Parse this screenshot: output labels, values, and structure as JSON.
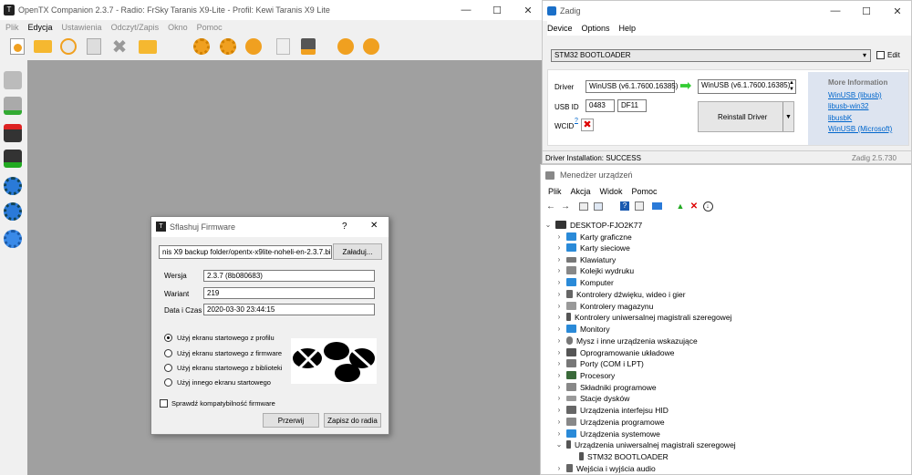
{
  "opentx": {
    "title": "OpenTX Companion 2.3.7 - Radio: FrSky Taranis X9-Lite - Profil: Kewi Taranis X9 Lite",
    "app_icon": "T",
    "menu": [
      "Plik",
      "Edycja",
      "Ustawienia",
      "Odczyt/Zapis",
      "Okno",
      "Pomoc"
    ],
    "toolbar_icons": [
      "new-file-icon",
      "open-folder-icon",
      "recent-files-icon",
      "save-icon",
      "close-x-icon",
      "model-folder-icon",
      "settings-gear-icon",
      "profile-gear-icon",
      "radio-settings-icon",
      "logs-icon",
      "sd-card-icon",
      "sync-icon",
      "download-firmware-icon"
    ],
    "side_icons": [
      "read-model-icon",
      "write-model-icon",
      "read-backup-icon",
      "write-backup-icon",
      "read-firmware-icon",
      "write-firmware-icon",
      "flash-firmware-icon"
    ]
  },
  "flash_dialog": {
    "title": "Sflashuj Firmware",
    "help": "?",
    "close": "✕",
    "file_path": "nis X9 backup folder/opentx-x9lite-noheli-en-2.3.7.bin",
    "load_button": "Załaduj...",
    "version_label": "Wersja",
    "version_value": "2.3.7 (8b080683)",
    "variant_label": "Wariant",
    "variant_value": "219",
    "date_label": "Data i Czas",
    "date_value": "2020-03-30 23:44:15",
    "radio_options": [
      "Użyj ekranu startowego z profilu",
      "Użyj ekranu startowego z firmware",
      "Użyj ekranu startowego z biblioteki",
      "Użyj innego ekranu startowego"
    ],
    "selected_option": 0,
    "check_compat": "Sprawdź kompatybilność firmware",
    "cancel_button": "Przerwij",
    "write_button": "Zapisz do radia"
  },
  "zadig": {
    "title": "Zadig",
    "menu": [
      "Device",
      "Options",
      "Help"
    ],
    "device": "STM32  BOOTLOADER",
    "edit_label": "Edit",
    "driver_label": "Driver",
    "driver_current": "WinUSB (v6.1.7600.16385)",
    "driver_target": "WinUSB (v6.1.7600.16385)",
    "usbid_label": "USB ID",
    "usb_vid": "0483",
    "usb_pid": "DF11",
    "wcid_label": "WCID",
    "wcid_sup": "?",
    "reinstall_button": "Reinstall Driver",
    "more_info_title": "More Information",
    "links": [
      "WinUSB (libusb)",
      "libusb-win32",
      "libusbK",
      "WinUSB (Microsoft)"
    ],
    "status": "Driver Installation: SUCCESS",
    "version": "Zadig 2.5.730"
  },
  "devmgr": {
    "title": "Menedżer urządzeń",
    "menu": [
      "Plik",
      "Akcja",
      "Widok",
      "Pomoc"
    ],
    "root": "DESKTOP-FJO2K77",
    "items": [
      "Karty graficzne",
      "Karty sieciowe",
      "Klawiatury",
      "Kolejki wydruku",
      "Komputer",
      "Kontrolery dźwięku, wideo i gier",
      "Kontrolery magazynu",
      "Kontrolery uniwersalnej magistrali szeregowej",
      "Monitory",
      "Mysz i inne urządzenia wskazujące",
      "Oprogramowanie układowe",
      "Porty (COM i LPT)",
      "Procesory",
      "Składniki programowe",
      "Stacje dysków",
      "Urządzenia interfejsu HID",
      "Urządzenia programowe",
      "Urządzenia systemowe",
      "Urządzenia uniwersalnej magistrali szeregowej"
    ],
    "child": "STM32  BOOTLOADER",
    "last": "Wejścia i wyjścia audio"
  },
  "window_controls": {
    "min": "—",
    "max": "☐",
    "close": "✕"
  },
  "colors": {
    "otx_orange": "#f0a020",
    "gray_workspace": "#a0a0a0",
    "zadig_blue": "#0066cc",
    "accent": "#1a6fc8"
  }
}
